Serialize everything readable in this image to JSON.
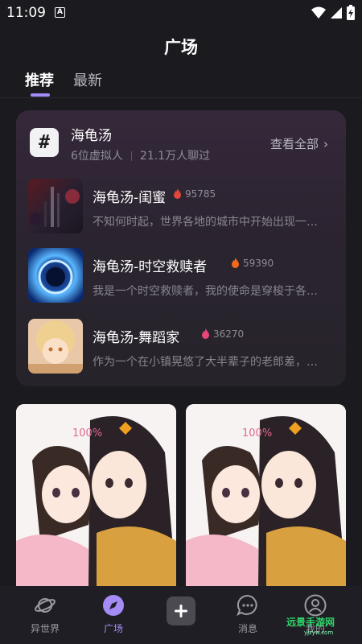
{
  "status_bar": {
    "time": "11:09",
    "notification_badge": "A"
  },
  "header": {
    "title": "广场"
  },
  "tabs": [
    {
      "label": "推荐",
      "active": true
    },
    {
      "label": "最新",
      "active": false
    }
  ],
  "topic": {
    "icon": "#",
    "name": "海龟汤",
    "members": "6位虚拟人",
    "chats": "21.1万人聊过",
    "view_all_label": "查看全部"
  },
  "stories": [
    {
      "title": "海龟汤-闺蜜",
      "heat": "95785",
      "heat_color": "#e0483a",
      "description": "不知何时起，世界各地的城市中开始出现一…"
    },
    {
      "title": "海龟汤-时空救赎者",
      "heat": "59390",
      "heat_color": "#f06a1a",
      "description": "我是一个时空救赎者，我的使命是穿梭于各…"
    },
    {
      "title": "海龟汤-舞蹈家",
      "heat": "36270",
      "heat_color": "#e8457a",
      "description": "作为一个在小镇晃悠了大半辈子的老郎差，…"
    }
  ],
  "bottom_nav": [
    {
      "label": "异世界",
      "icon": "planet-icon",
      "active": false
    },
    {
      "label": "广场",
      "icon": "compass-icon",
      "active": true
    },
    {
      "label": "",
      "icon": "plus-icon",
      "active": false
    },
    {
      "label": "消息",
      "icon": "chat-bubble-icon",
      "active": false
    },
    {
      "label": "我的",
      "icon": "user-icon",
      "active": false
    }
  ],
  "watermark": {
    "text": "远景手游网",
    "sub": "yjzyw.com"
  },
  "colors": {
    "accent": "#a58bf5",
    "background": "#1b1a1f",
    "card": "#2b2430"
  }
}
